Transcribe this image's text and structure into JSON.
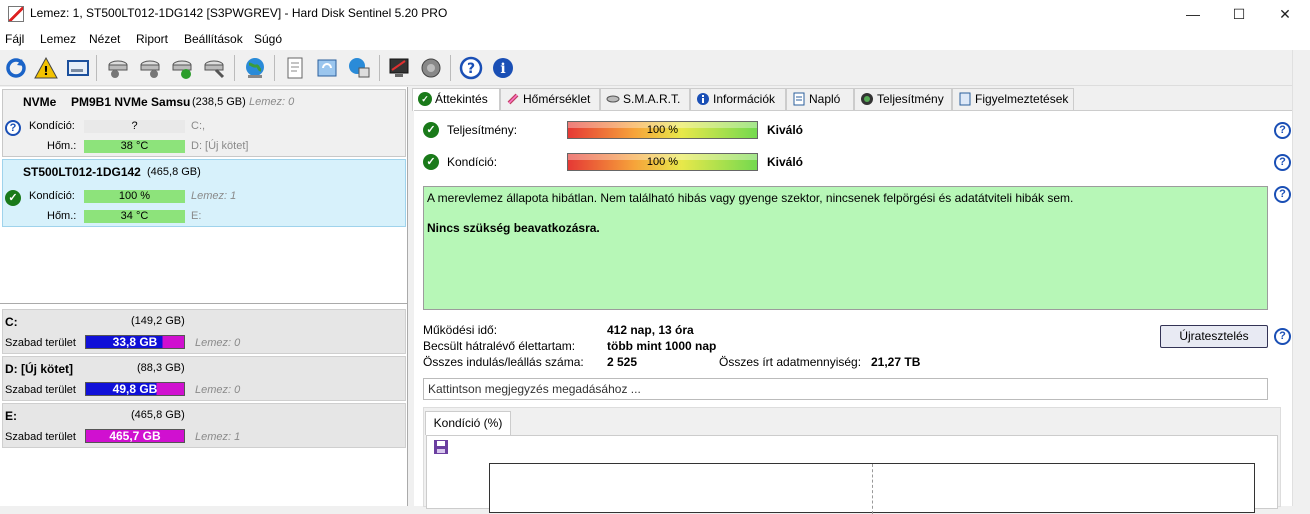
{
  "window": {
    "title": "Lemez: 1, ST500LT012-1DG142 [S3PWGREV]  -  Hard Disk Sentinel 5.20 PRO",
    "minimize": "—",
    "maximize": "☐",
    "close": "✕"
  },
  "menu": [
    "Fájl",
    "Lemez",
    "Nézet",
    "Riport",
    "Beállítások",
    "Súgó"
  ],
  "toolbar": {
    "icons": [
      "refresh-icon",
      "warning-icon",
      "drive-icon",
      "disk-test-icon",
      "disk-test-2-icon",
      "disk-test-ok-icon",
      "disk-test-settings-icon",
      "globe-icon",
      "report-icon",
      "update-icon",
      "network-icon",
      "monitor-icon",
      "speaker-icon",
      "help-icon",
      "info-icon"
    ]
  },
  "disks": [
    {
      "name_prefix": "NVMe",
      "name": "PM9B1 NVMe Samsu",
      "size": "(238,5 GB)",
      "lemez": "Lemez: 0",
      "kondicio_label": "Kondíció:",
      "kondicio_value": "?",
      "hom_label": "Hőm.:",
      "hom_value": "38 °C",
      "drive1": "C:,",
      "drive2": "D: [Új kötet]",
      "status_icon": "question-icon"
    },
    {
      "name": "ST500LT012-1DG142",
      "size": "(465,8 GB)",
      "lemez": "Lemez: 1",
      "kondicio_label": "Kondíció:",
      "kondicio_value": "100 %",
      "hom_label": "Hőm.:",
      "hom_value": "34 °C",
      "drive1": "E:",
      "status_icon": "ok-icon"
    }
  ],
  "partitions": [
    {
      "name": "C:",
      "size": "(149,2 GB)",
      "free_label": "Szabad terület",
      "free": "33,8 GB",
      "lemez": "Lemez: 0",
      "fill": 0.78
    },
    {
      "name": "D: [Új kötet]",
      "size": "(88,3 GB)",
      "free_label": "Szabad terület",
      "free": "49,8 GB",
      "lemez": "Lemez: 0",
      "fill": 0.72
    },
    {
      "name": "E:",
      "size": "(465,8 GB)",
      "free_label": "Szabad terület",
      "free": "465,7 GB",
      "lemez": "Lemez: 1",
      "fill": 0
    }
  ],
  "tabs": [
    "Áttekintés",
    "Hőmérséklet",
    "S.M.A.R.T.",
    "Információk",
    "Napló",
    "Teljesítmény",
    "Figyelmeztetések"
  ],
  "overview": {
    "perf_label": "Teljesítmény:",
    "perf_value": "100 %",
    "perf_word": "Kiváló",
    "cond_label": "Kondíció:",
    "cond_value": "100 %",
    "cond_word": "Kiváló",
    "status_text": "A merevlemez állapota hibátlan. Nem található hibás vagy gyenge szektor, nincsenek felpörgési és adatátviteli hibák sem.",
    "status_bold": "Nincs szükség beavatkozásra.",
    "uptime_label": "Működési idő:",
    "uptime_value": "412 nap, 13 óra",
    "life_label": "Becsült hátralévő élettartam:",
    "life_value": "több mint 1000 nap",
    "starts_label": "Összes indulás/leállás száma:",
    "starts_value": "2 525",
    "written_label": "Összes írt adatmennyiség:",
    "written_value": "21,27 TB",
    "retest_button": "Újratesztelés",
    "comment_placeholder": "Kattintson megjegyzés megadásához ...",
    "chart_tab": "Kondíció  (%)"
  },
  "colors": {
    "selected_disk": "#d7f1fb",
    "status_green": "#b7f7b7",
    "bar_green": "#8de37b",
    "free_blue": "#1010d8",
    "free_magenta": "#d010d0"
  }
}
